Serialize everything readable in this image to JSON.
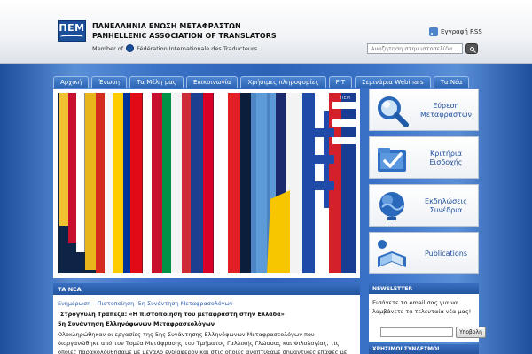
{
  "header": {
    "logo_text": "ΠΕΜ",
    "org_name_gr": "ΠΑΝΕΛΛΗΝΙΑ ΕΝΩΣΗ ΜΕΤΑΦΡΑΣΤΩΝ",
    "org_name_en": "PANHELLENIC ASSOCIATION OF TRANSLATORS",
    "member_prefix": "Member of",
    "member_org": "Fédération Internationale des Traducteurs",
    "rss_label": "Εγγραφή RSS",
    "search_placeholder": "Αναζήτηση στην ιστοσελίδα..."
  },
  "nav": {
    "items": [
      "Αρχική",
      "Ένωση",
      "Τα Μέλη μας",
      "Επικοινωνία",
      "Χρήσιμες πληροφορίες",
      "FIT",
      "Σεμινάρια Webinars",
      "Τα Νέα"
    ]
  },
  "slider": {
    "tag": "ΠΕΜ"
  },
  "sidebar": {
    "boxes": [
      {
        "line1": "Εύρεση",
        "line2": "Μεταφραστών",
        "icon": "magnifier-icon"
      },
      {
        "line1": "Κριτήρια",
        "line2": "Εισδοχής",
        "icon": "folder-check-icon"
      },
      {
        "line1": "Εκδηλώσεις",
        "line2": "Συνέδρια",
        "icon": "globe-icon"
      },
      {
        "line1": "Publications",
        "line2": "",
        "icon": "book-icon"
      }
    ]
  },
  "news": {
    "heading": "ΤΑ ΝΕΑ",
    "link": "Ενημέρωση – Πιστοποίηση -5η Συνάντηση Μεταφρασολόγων",
    "subtitle": "Στρογγυλή Τράπεζα: «Η πιστοποίηση του μεταφραστή στην Ελλάδα»",
    "meeting": "5η Συνάντηση Ελληνόφωνων Μεταφρασεολόγων",
    "body": "Ολοκληρώθηκαν οι εργασίες της 5ης Συνάντησης Ελληνόφωνων Μεταφρασεολόγων που διοργανώθηκε από τον Τομέα Μετάφρασης του Τμήματος Γαλλικής Γλώσσας και Φιλολογίας, τις οποίες παρακολουθήσαμε με μεγάλο ενδιαφέρον και στις οποίες αναπτύξαμε σημαντικές επαφές με διακεκριμένους ανθρώπους της"
  },
  "newsletter": {
    "heading": "NEWSLETTER",
    "text": "Εισάγετε το email σας για να λαμβάνετε τα τελευταία νέα μας!",
    "button": "Υποβολή"
  },
  "links": {
    "heading": "ΧΡΗΣΙΜΟΙ ΣΥΝΔΕΣΜΟΙ"
  },
  "colors": {
    "accent": "#2c65b4",
    "link": "#2b5fb3",
    "background": "#3a72c8"
  }
}
